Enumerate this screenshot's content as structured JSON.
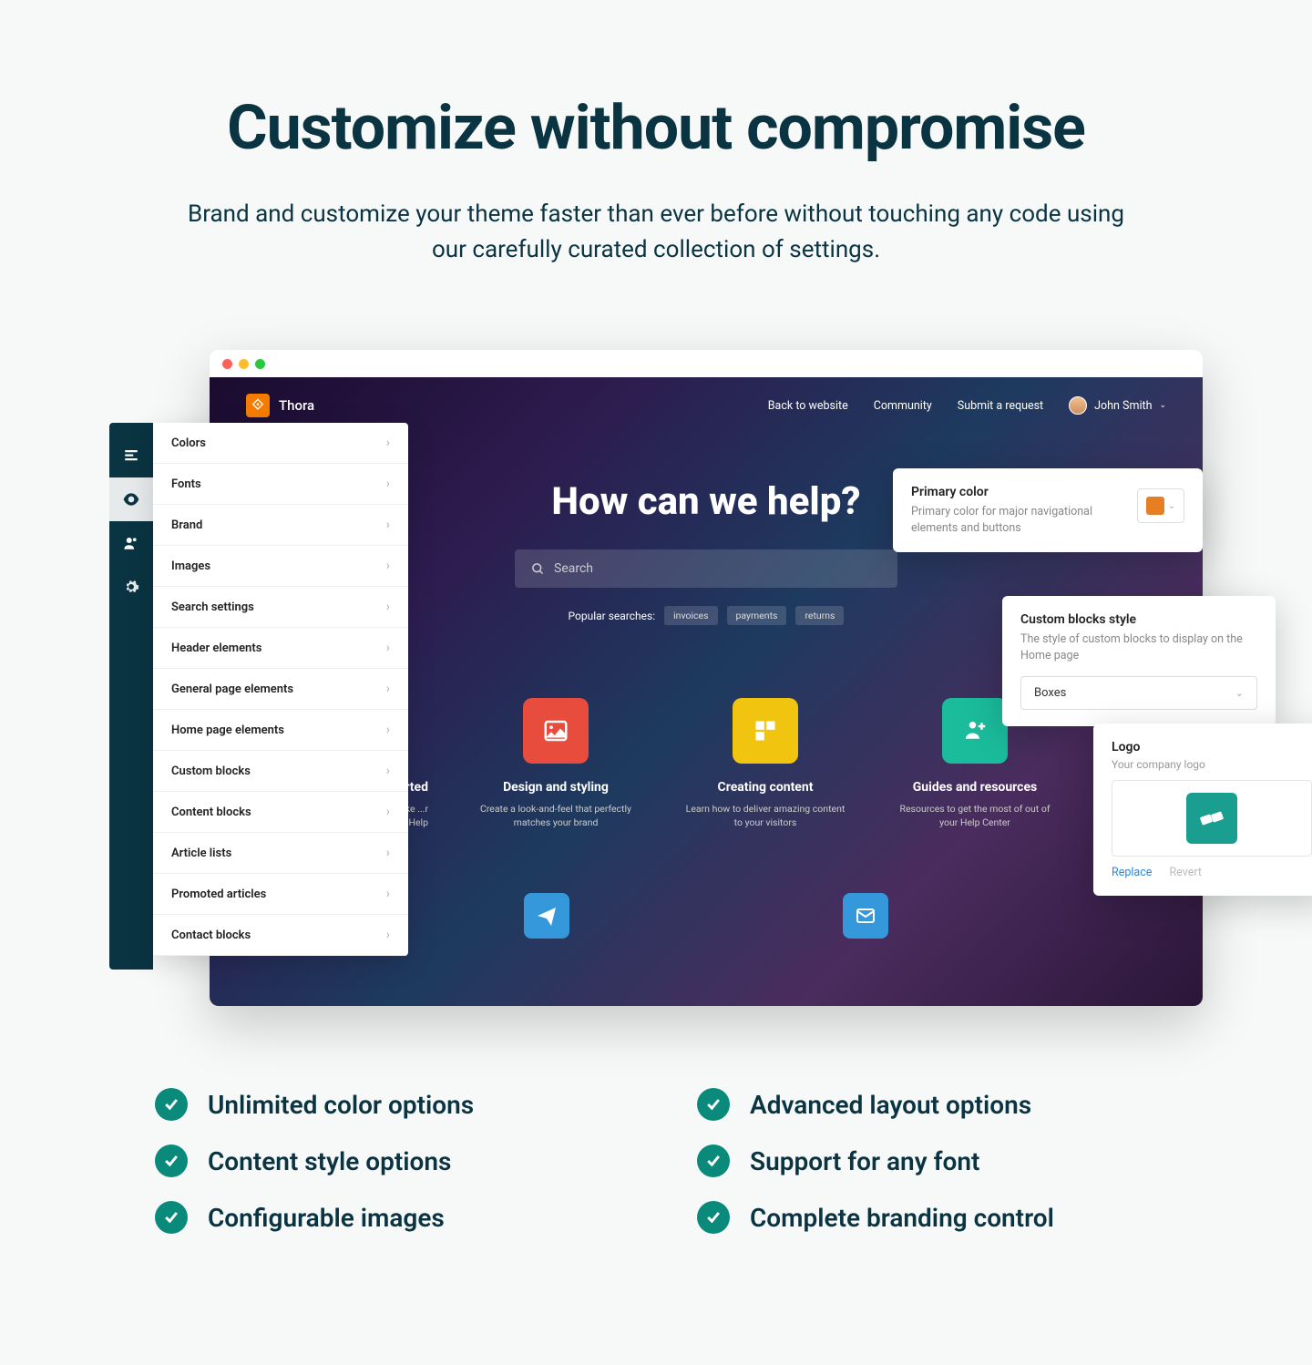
{
  "hero": {
    "title": "Customize without compromise",
    "subtitle": "Brand and customize your theme faster than ever before without touching any code using our carefully curated collection of settings."
  },
  "settings_list": [
    "Colors",
    "Fonts",
    "Brand",
    "Images",
    "Search settings",
    "Header elements",
    "General page elements",
    "Home page elements",
    "Custom blocks",
    "Content blocks",
    "Article lists",
    "Promoted articles",
    "Contact blocks"
  ],
  "site": {
    "brand": "Thora",
    "nav": [
      "Back to website",
      "Community",
      "Submit a request"
    ],
    "user": "John Smith",
    "hero_title": "How can we help?",
    "search_placeholder": "Search",
    "popular_label": "Popular searches:",
    "popular": [
      "invoices",
      "payments",
      "returns"
    ],
    "blocks": [
      {
        "title": "...rted",
        "desc": "...to make ...r Help"
      },
      {
        "title": "Design and styling",
        "desc": "Create a look-and-feel that perfectly matches your brand"
      },
      {
        "title": "Creating content",
        "desc": "Learn how to deliver amazing content to your visitors"
      },
      {
        "title": "Guides and resources",
        "desc": "Resources to get the most of out of your Help Center"
      }
    ]
  },
  "card_primary": {
    "title": "Primary color",
    "desc": "Primary color for major navigational elements and buttons",
    "color": "#e67e22"
  },
  "card_custom": {
    "title": "Custom blocks style",
    "desc": "The style of custom blocks to display on the Home page",
    "value": "Boxes"
  },
  "card_logo": {
    "title": "Logo",
    "desc": "Your company logo",
    "replace": "Replace",
    "revert": "Revert"
  },
  "features": [
    "Unlimited color options",
    "Advanced layout options",
    "Content style options",
    "Support for any font",
    "Configurable images",
    "Complete branding control"
  ]
}
